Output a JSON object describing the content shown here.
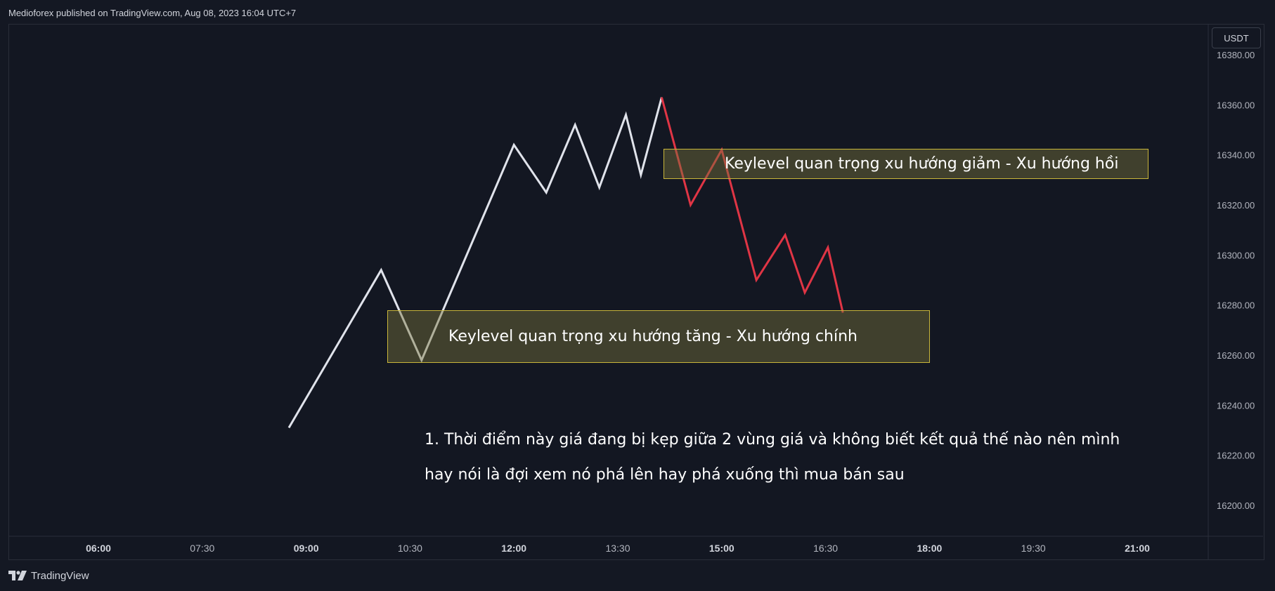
{
  "header": {
    "published": "Medioforex published on TradingView.com, Aug 08, 2023 16:04 UTC+7"
  },
  "currency_label": "USDT",
  "footer": {
    "brand": "TradingView",
    "logo_icon": "tradingview-logo-icon"
  },
  "annotations": {
    "upper_box": "Keylevel quan trọng xu hướng giảm - Xu hướng hồi",
    "lower_box": "Keylevel quan trọng xu hướng tăng - Xu hướng chính",
    "note_line1": "1. Thời điểm này giá đang bị kẹp giữa 2 vùng giá và không biết kết quả thế nào nên mình",
    "note_line2": "hay nói là đợi xem nó phá lên hay phá xuống thì mua bán sau"
  },
  "colors": {
    "background": "#131722",
    "up_line": "#e0e3eb",
    "down_line": "#e03545",
    "box_border": "#c9b63a",
    "box_fill": "#5a5730"
  },
  "chart_data": {
    "type": "line",
    "xlabel": "",
    "ylabel": "",
    "y_ticks": [
      "16380.00",
      "16360.00",
      "16340.00",
      "16320.00",
      "16300.00",
      "16280.00",
      "16260.00",
      "16240.00",
      "16220.00",
      "16200.00"
    ],
    "x_ticks": [
      "06:00",
      "07:30",
      "09:00",
      "10:30",
      "12:00",
      "13:30",
      "15:00",
      "16:30",
      "18:00",
      "19:30",
      "21:00"
    ],
    "x_ticks_bold": [
      true,
      false,
      true,
      false,
      true,
      false,
      true,
      false,
      true,
      false,
      true
    ],
    "ylim": [
      16190,
      16393
    ],
    "xlim_hours": [
      5.2,
      22.0
    ],
    "series": [
      {
        "color": "#e0e3eb",
        "points": [
          [
            "08:45",
            16231
          ],
          [
            "10:05",
            16294
          ],
          [
            "10:40",
            16258
          ],
          [
            "12:00",
            16344
          ],
          [
            "12:28",
            16325
          ],
          [
            "12:53",
            16352
          ],
          [
            "13:14",
            16327
          ],
          [
            "13:37",
            16356
          ],
          [
            "13:50",
            16332
          ],
          [
            "14:08",
            16363
          ]
        ]
      },
      {
        "color": "#e03545",
        "points": [
          [
            "14:08",
            16363
          ],
          [
            "14:33",
            16320
          ],
          [
            "15:00",
            16342
          ],
          [
            "15:30",
            16290
          ],
          [
            "15:55",
            16308
          ],
          [
            "16:12",
            16285
          ],
          [
            "16:32",
            16303
          ],
          [
            "16:45",
            16277
          ]
        ]
      }
    ]
  }
}
